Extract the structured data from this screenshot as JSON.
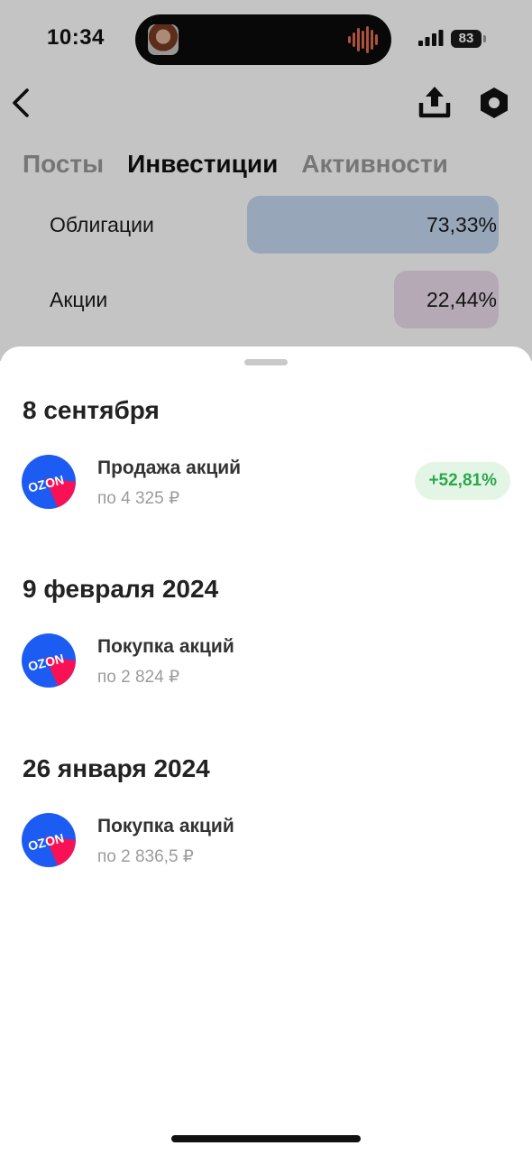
{
  "status_bar": {
    "time": "10:34",
    "battery": "83"
  },
  "nav": {
    "back_icon": "chevron-left-icon",
    "share_icon": "share-upload-icon",
    "settings_icon": "hexagon-settings-icon"
  },
  "tabs": [
    {
      "label": "Посты",
      "active": false
    },
    {
      "label": "Инвестиции",
      "active": true
    },
    {
      "label": "Активности",
      "active": false
    }
  ],
  "allocation": [
    {
      "label": "Облигации",
      "value": "73,33%",
      "share": 0.7333,
      "color": "#c6d8f3"
    },
    {
      "label": "Акции",
      "value": "22,44%",
      "share": 0.2244,
      "color": "#ebdcec"
    }
  ],
  "operations": [
    {
      "date": "8 сентября",
      "items": [
        {
          "title": "Продажа акций",
          "price": "по 4 325 ₽",
          "badge": "+52,81%",
          "logo_text": "OZON"
        }
      ]
    },
    {
      "date": "9 февраля 2024",
      "items": [
        {
          "title": "Покупка акций",
          "price": "по 2 824 ₽",
          "logo_text": "OZON"
        }
      ]
    },
    {
      "date": "26 января 2024",
      "items": [
        {
          "title": "Покупка акций",
          "price": "по 2 836,5 ₽",
          "logo_text": "OZON"
        }
      ]
    }
  ],
  "colors": {
    "ozon_blue": "#1c5cf2",
    "ozon_pink": "#f91155",
    "positive_green": "#2ca84a",
    "positive_bg": "#e3f6e6"
  }
}
